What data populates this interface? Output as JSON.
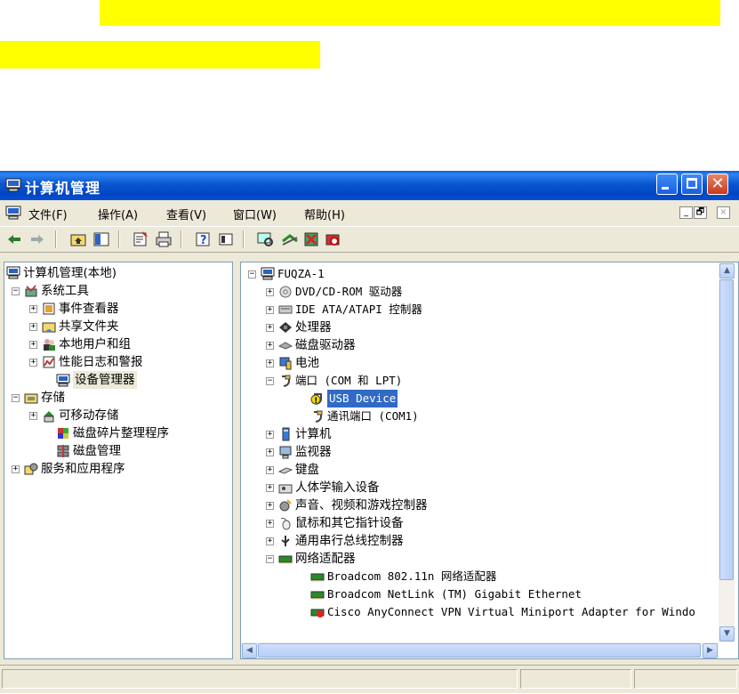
{
  "window": {
    "title": "计算机管理"
  },
  "menu": [
    "文件(F)",
    "操作(A)",
    "查看(V)",
    "窗口(W)",
    "帮助(H)"
  ],
  "mdi_controls": [
    "_",
    "🗗",
    "×"
  ],
  "left_tree": {
    "root": "计算机管理(本地)",
    "system_tools": "系统工具",
    "event_viewer": "事件查看器",
    "shared_folders": "共享文件夹",
    "local_users": "本地用户和组",
    "perf_logs": "性能日志和警报",
    "device_manager": "设备管理器",
    "storage": "存储",
    "removable": "可移动存储",
    "defrag": "磁盘碎片整理程序",
    "disk_mgmt": "磁盘管理",
    "services_apps": "服务和应用程序"
  },
  "right_tree": {
    "root": "FUQZA-1",
    "dvd": "DVD/CD-ROM 驱动器",
    "ide": "IDE ATA/ATAPI 控制器",
    "cpu": "处理器",
    "disk": "磁盘驱动器",
    "battery": "电池",
    "ports": "端口 (COM 和 LPT)",
    "usb_device": "USB Device",
    "com1": "通讯端口 (COM1)",
    "computer": "计算机",
    "monitor": "监视器",
    "keyboard": "键盘",
    "hid": "人体学输入设备",
    "sound": "声音、视频和游戏控制器",
    "mouse": "鼠标和其它指针设备",
    "usb_ctrl": "通用串行总线控制器",
    "net_adapters": "网络适配器",
    "net1": "Broadcom 802.11n 网络适配器",
    "net2": "Broadcom NetLink (TM) Gigabit Ethernet",
    "net3": "Cisco AnyConnect VPN Virtual Miniport Adapter for Windo"
  },
  "colors": {
    "selection": "#316ac5",
    "titlebar": "#0a55d0",
    "highlight": "#ffff00"
  },
  "icons": [
    "computer-icon",
    "back-arrow-icon",
    "forward-arrow-icon",
    "up-folder-icon",
    "show-tree-icon",
    "properties-icon",
    "print-icon",
    "help-icon",
    "console-icon",
    "scan-hardware-icon",
    "update-driver-icon",
    "uninstall-icon",
    "disable-device-icon",
    "warning-icon"
  ]
}
